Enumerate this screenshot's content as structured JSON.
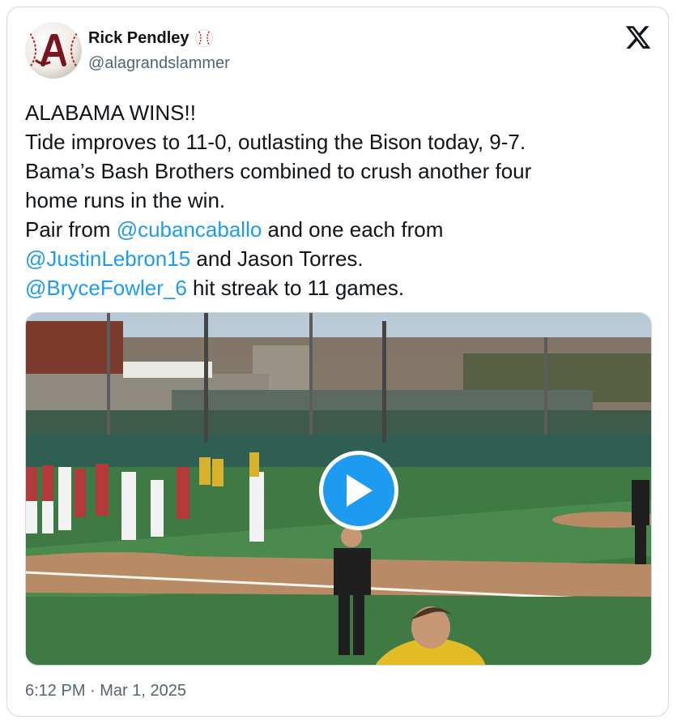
{
  "tweet": {
    "author": {
      "display_name": "Rick Pendley",
      "handle": "@alagrandslammer",
      "badge_icon": "baseball-icon",
      "avatar_icon": "script-a-baseball-icon"
    },
    "lines": [
      [
        {
          "text": "ALABAMA WINS!!",
          "mention": false
        }
      ],
      [
        {
          "text": "Tide improves to 11-0, outlasting the Bison today, 9-7.",
          "mention": false
        }
      ],
      [
        {
          "text": "Bama’s Bash Brothers combined to crush another four",
          "mention": false
        }
      ],
      [
        {
          "text": "home runs in the win.",
          "mention": false
        }
      ],
      [
        {
          "text": "Pair from ",
          "mention": false
        },
        {
          "text": "@cubancaballo",
          "mention": true
        },
        {
          "text": " and one each from",
          "mention": false
        }
      ],
      [
        {
          "text": "@JustinLebron15",
          "mention": true
        },
        {
          "text": " and Jason Torres.",
          "mention": false
        }
      ],
      [
        {
          "text": "@BryceFowler_6",
          "mention": true
        },
        {
          "text": " hit streak to 11 games.",
          "mention": false
        }
      ]
    ],
    "media": {
      "type": "video",
      "play_icon": "play-icon"
    },
    "timestamp": "6:12 PM · Mar 1, 2025"
  },
  "platform": {
    "logo_icon": "x-logo-icon"
  },
  "colors": {
    "link": "#1d9bf0",
    "text": "#0f1419",
    "muted": "#536471",
    "border": "#cfd9de",
    "play_button": "#1d9bf0"
  }
}
